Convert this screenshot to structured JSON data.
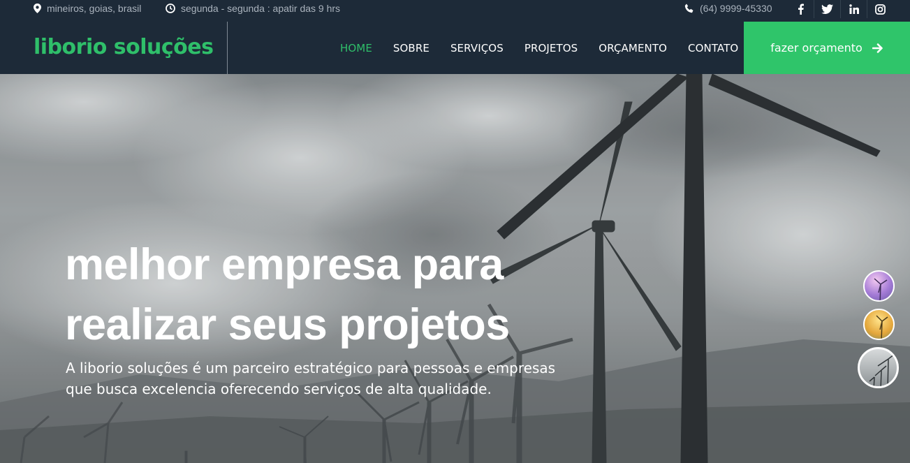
{
  "topbar": {
    "location": "mineiros, goias, brasil",
    "hours": "segunda - segunda : apatir das 9 hrs",
    "phone": "(64) 9999-45330",
    "social": [
      {
        "icon": "facebook-icon",
        "label": "f"
      },
      {
        "icon": "twitter-icon",
        "label": "t"
      },
      {
        "icon": "linkedin-icon",
        "label": "in"
      },
      {
        "icon": "instagram-icon",
        "label": "ig"
      }
    ]
  },
  "nav": {
    "brand": "liborio soluções",
    "items": [
      "HOME",
      "SOBRE",
      "SERVIÇOS",
      "PROJETOS",
      "ORÇAMENTO",
      "CONTATO"
    ],
    "active": "HOME",
    "cta": "fazer orçamento"
  },
  "hero": {
    "line1": "melhor empresa para",
    "line2": "realizar seus projetos",
    "subtitle": "A liborio soluções é um parceiro estratégico para pessoas e empresas que busca excelencia oferecendo serviços de alta qualidade."
  },
  "colors": {
    "dark": "#1d2a38",
    "accent": "#2fc56a"
  }
}
